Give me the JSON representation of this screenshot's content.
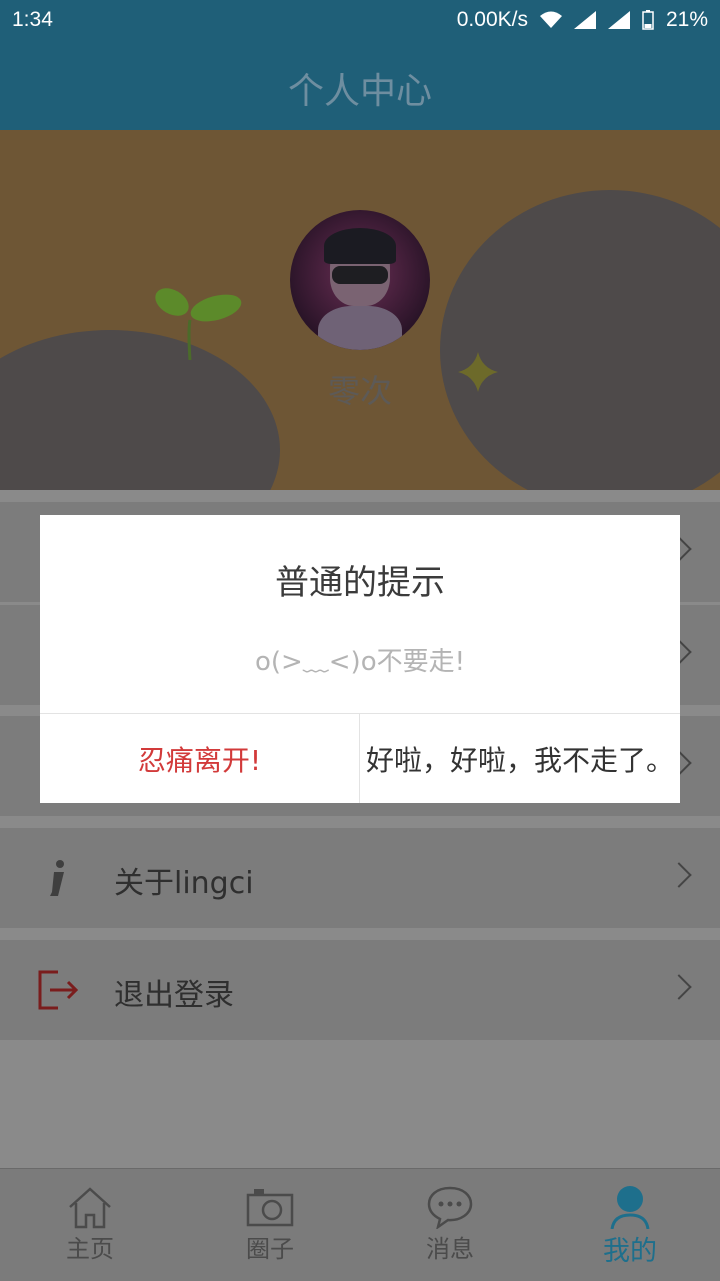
{
  "status_bar": {
    "time": "1:34",
    "network_speed": "0.00K/s",
    "battery": "21%"
  },
  "header": {
    "title": "个人中心"
  },
  "profile": {
    "username": "零次"
  },
  "menu": {
    "items": [
      {
        "label": "关于lingci",
        "icon": "info-icon"
      },
      {
        "label": "退出登录",
        "icon": "logout-icon"
      }
    ]
  },
  "dialog": {
    "title": "普通的提示",
    "message": "o(>﹏<)o不要走!",
    "leave_label": "忍痛离开!",
    "stay_label": "好啦，好啦，我不走了。"
  },
  "tabs": [
    {
      "label": "主页",
      "icon": "home-icon"
    },
    {
      "label": "圈子",
      "icon": "camera-icon"
    },
    {
      "label": "消息",
      "icon": "message-icon"
    },
    {
      "label": "我的",
      "icon": "person-icon",
      "active": true
    }
  ],
  "colors": {
    "primary": "#1f5f78",
    "danger": "#d23a3a",
    "active_tab": "#1e6f8c"
  }
}
